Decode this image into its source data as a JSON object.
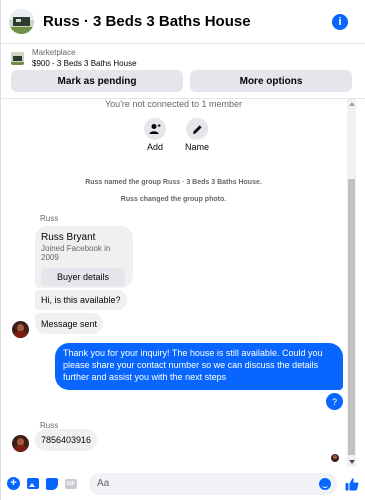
{
  "header": {
    "title": "Russ · 3 Beds 3 Baths House",
    "info_icon_glyph": "i"
  },
  "marketplace": {
    "label": "Marketplace",
    "listing": "$900 - 3 Beds 3 Baths House",
    "mark_pending_label": "Mark as pending",
    "more_options_label": "More options"
  },
  "conversation": {
    "not_connected_text": "You're not connected to 1 member",
    "actions": [
      {
        "label": "Add",
        "icon": "add-person-icon"
      },
      {
        "label": "Name",
        "icon": "pencil-icon"
      }
    ],
    "system_messages": [
      "Russ named the group Russ · 3 Beds 3 Baths House.",
      "Russ changed the group photo."
    ],
    "profile_card": {
      "sender": "Russ",
      "name": "Russ Bryant",
      "subtitle": "Joined Facebook in 2009",
      "button_label": "Buyer details"
    },
    "messages": [
      {
        "from": "Russ",
        "text": "Hi, is this available?"
      },
      {
        "from": "Russ",
        "text": "Message sent"
      },
      {
        "from": "me",
        "text": "Thank you for your inquiry! The house is still available. Could you please share your contact number so we can discuss the details further and assist you with the next steps"
      },
      {
        "from": "me",
        "text": "?"
      },
      {
        "from": "Russ",
        "sender_label": "Russ",
        "text": "7856403916"
      }
    ]
  },
  "composer": {
    "placeholder": "Aa",
    "icons": [
      "plus-icon",
      "photo-icon",
      "sticker-icon",
      "gif-icon",
      "emoji-icon",
      "thumbs-up-icon"
    ],
    "gif_label": "GIF"
  },
  "colors": {
    "accent": "#0866ff",
    "bubble_gray": "#f0f0f0",
    "secondary_text": "#65676b"
  }
}
